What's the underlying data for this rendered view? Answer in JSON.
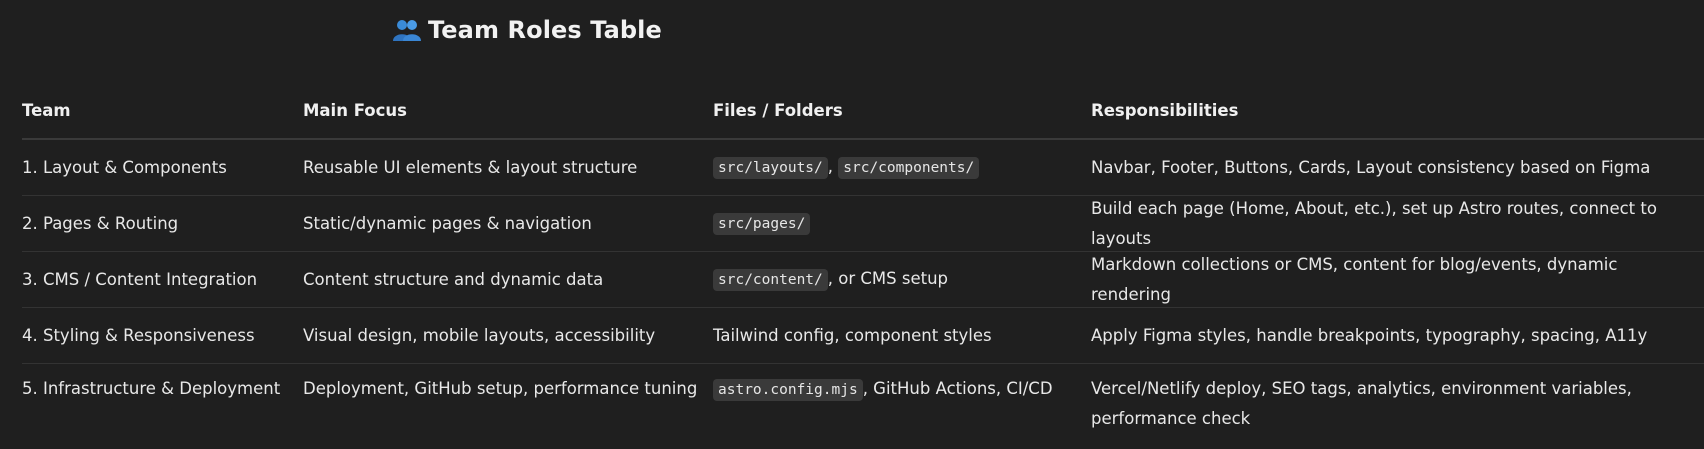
{
  "page": {
    "title": "Team Roles Table",
    "title_icon": "people-emoji-icon"
  },
  "table": {
    "headers": [
      "Team",
      "Main Focus",
      "Files / Folders",
      "Responsibilities"
    ],
    "rows": [
      {
        "team": "1. Layout & Components",
        "focus": "Reusable UI elements & layout structure",
        "files": {
          "code1": "src/layouts/",
          "sep": ", ",
          "code2": "src/components/",
          "text": ""
        },
        "responsibilities": "Navbar, Footer, Buttons, Cards, Layout consistency based on Figma"
      },
      {
        "team": "2. Pages & Routing",
        "focus": "Static/dynamic pages & navigation",
        "files": {
          "code1": "src/pages/",
          "text": ""
        },
        "responsibilities": "Build each page (Home, About, etc.), set up Astro routes, connect to layouts"
      },
      {
        "team": "3. CMS / Content Integration",
        "focus": "Content structure and dynamic data",
        "files": {
          "code1": "src/content/",
          "text": ", or CMS setup"
        },
        "responsibilities": "Markdown collections or CMS, content for blog/events, dynamic rendering"
      },
      {
        "team": "4. Styling & Responsiveness",
        "focus": "Visual design, mobile layouts, accessibility",
        "files": {
          "text": "Tailwind config, component styles"
        },
        "responsibilities": "Apply Figma styles, handle breakpoints, typography, spacing, A11y"
      },
      {
        "team": "5. Infrastructure & Deployment",
        "focus": "Deployment, GitHub setup, performance tuning",
        "files": {
          "code1": "astro.config.mjs",
          "text": ", GitHub Actions, CI/CD"
        },
        "responsibilities": "Vercel/Netlify deploy, SEO tags, analytics, environment variables, performance check"
      }
    ]
  }
}
